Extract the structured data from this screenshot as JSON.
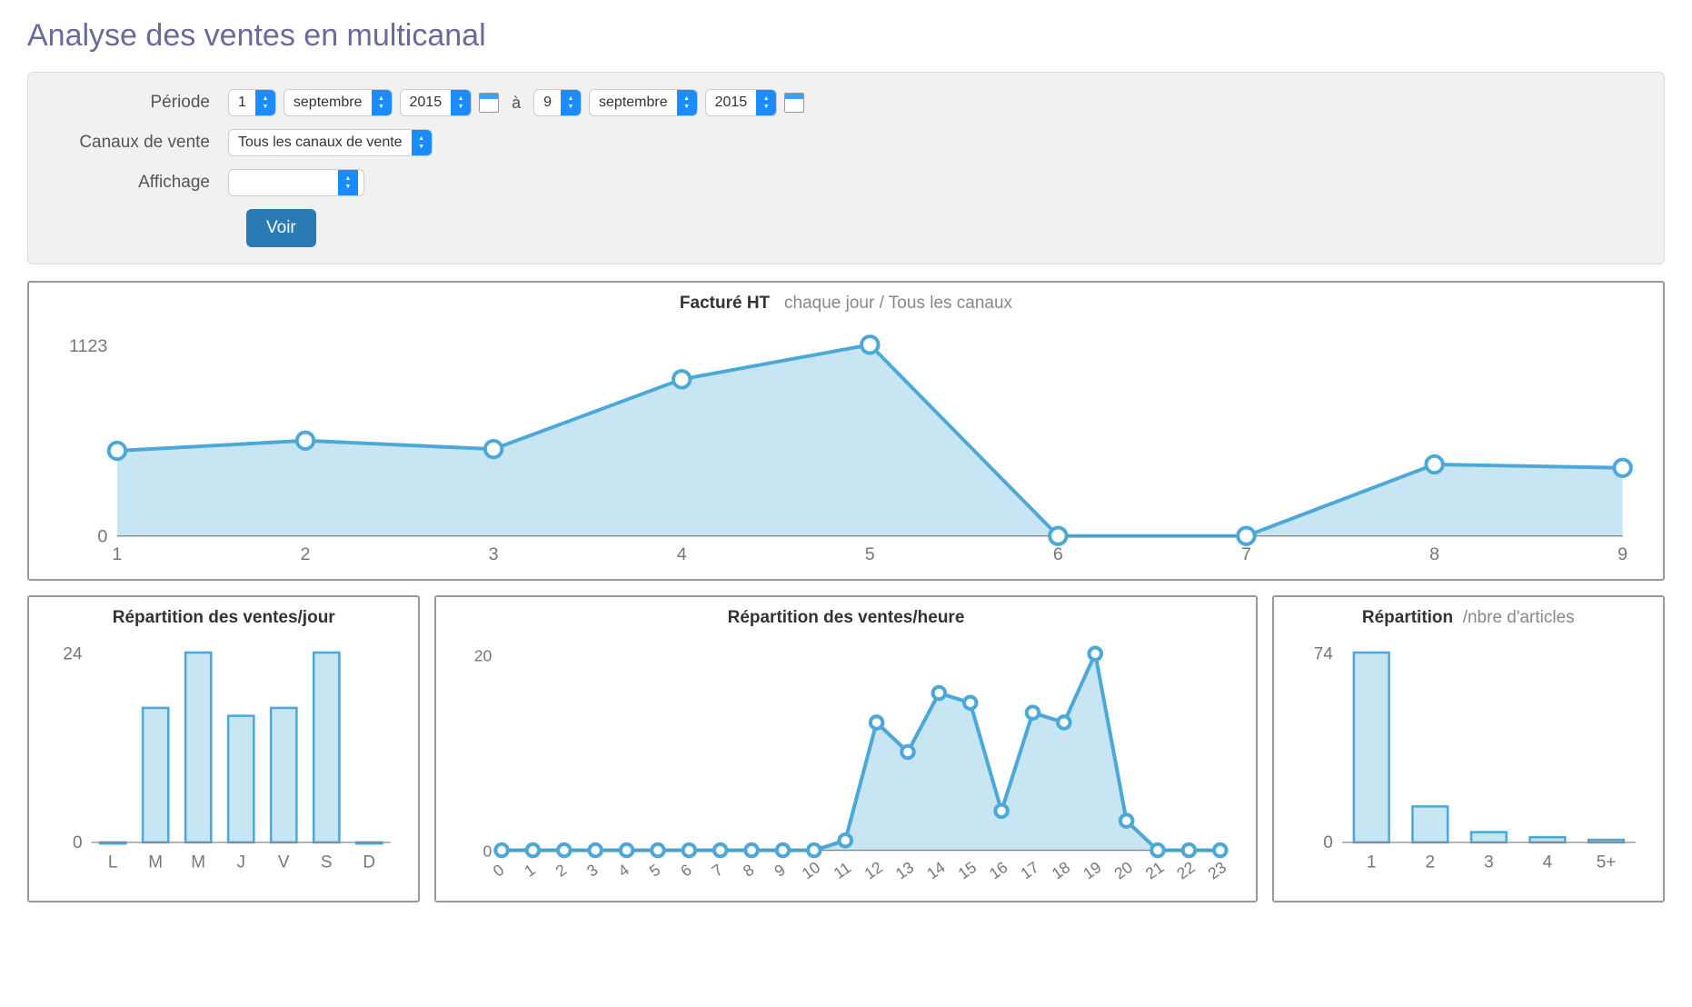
{
  "page_title": "Analyse des ventes en multicanal",
  "filters": {
    "period_label": "Période",
    "period_sep": "à",
    "start_day": "1",
    "start_month": "septembre",
    "start_year": "2015",
    "end_day": "9",
    "end_month": "septembre",
    "end_year": "2015",
    "channels_label": "Canaux de vente",
    "channels_value": "Tous les canaux de vente",
    "display_label": "Affichage",
    "display_value": "",
    "submit_label": "Voir"
  },
  "main_chart": {
    "title_bold": "Facturé HT",
    "title_sub": "chaque jour / Tous les canaux",
    "y_max_label": "1123",
    "y_min_label": "0"
  },
  "per_day_chart": {
    "title_bold": "Répartition des ventes/jour",
    "y_max_label": "24",
    "y_min_label": "0"
  },
  "per_hour_chart": {
    "title_bold": "Répartition des ventes/heure",
    "y_max_label": "20",
    "y_min_label": "0"
  },
  "per_articles_chart": {
    "title_bold": "Répartition",
    "title_sub": "/nbre d'articles",
    "y_max_label": "74",
    "y_min_label": "0"
  },
  "chart_data": [
    {
      "type": "area",
      "title": "Facturé HT chaque jour / Tous les canaux",
      "xlabel": "",
      "ylabel": "",
      "ylim": [
        0,
        1123
      ],
      "categories": [
        "1",
        "2",
        "3",
        "4",
        "5",
        "6",
        "7",
        "8",
        "9"
      ],
      "values": [
        500,
        560,
        510,
        920,
        1123,
        0,
        0,
        420,
        400
      ]
    },
    {
      "type": "bar",
      "title": "Répartition des ventes/jour",
      "xlabel": "",
      "ylabel": "",
      "ylim": [
        0,
        24
      ],
      "categories": [
        "L",
        "M",
        "M",
        "J",
        "V",
        "S",
        "D"
      ],
      "values": [
        0,
        17,
        24,
        16,
        17,
        24,
        0
      ]
    },
    {
      "type": "area",
      "title": "Répartition des ventes/heure",
      "xlabel": "",
      "ylabel": "",
      "ylim": [
        0,
        20
      ],
      "categories": [
        "0",
        "1",
        "2",
        "3",
        "4",
        "5",
        "6",
        "7",
        "8",
        "9",
        "10",
        "11",
        "12",
        "13",
        "14",
        "15",
        "16",
        "17",
        "18",
        "19",
        "20",
        "21",
        "22",
        "23"
      ],
      "values": [
        0,
        0,
        0,
        0,
        0,
        0,
        0,
        0,
        0,
        0,
        0,
        1,
        13,
        10,
        16,
        15,
        4,
        14,
        13,
        20,
        3,
        0,
        0,
        0
      ]
    },
    {
      "type": "bar",
      "title": "Répartition /nbre d'articles",
      "xlabel": "",
      "ylabel": "",
      "ylim": [
        0,
        74
      ],
      "categories": [
        "1",
        "2",
        "3",
        "4",
        "5+"
      ],
      "values": [
        74,
        14,
        4,
        2,
        1
      ]
    }
  ]
}
